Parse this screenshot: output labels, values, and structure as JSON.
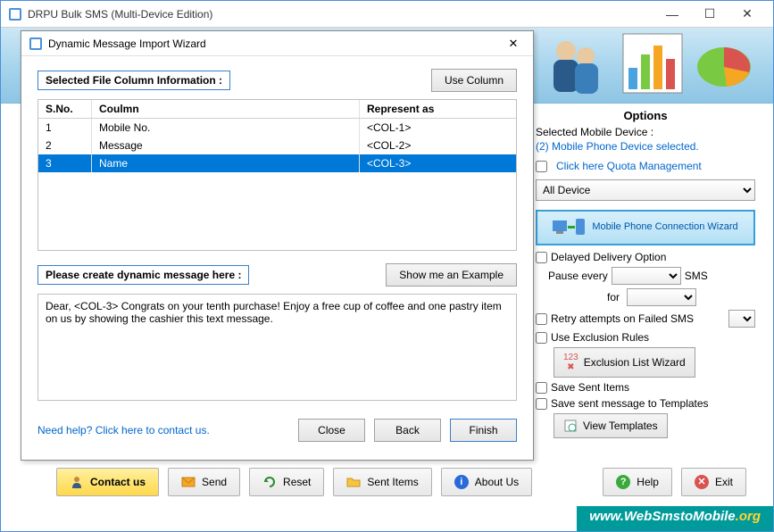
{
  "app": {
    "title": "DRPU Bulk SMS (Multi-Device Edition)"
  },
  "dialog": {
    "title": "Dynamic Message Import Wizard",
    "section1_label": "Selected File Column Information :",
    "use_column_btn": "Use Column",
    "table": {
      "headers": {
        "sno": "S.No.",
        "column": "Coulmn",
        "represent": "Represent as"
      },
      "rows": [
        {
          "sno": "1",
          "column": "Mobile No.",
          "represent": "<COL-1>",
          "selected": false
        },
        {
          "sno": "2",
          "column": "Message",
          "represent": "<COL-2>",
          "selected": false
        },
        {
          "sno": "3",
          "column": "Name",
          "represent": "<COL-3>",
          "selected": true
        }
      ]
    },
    "section2_label": "Please create dynamic message here :",
    "example_btn": "Show me an Example",
    "message_text": "Dear, <COL-3> Congrats on your tenth purchase! Enjoy a free cup of coffee and one pastry item on us by showing the cashier this text message.",
    "help_link": "Need help? Click here to contact us.",
    "close_btn": "Close",
    "back_btn": "Back",
    "finish_btn": "Finish"
  },
  "options": {
    "title": "Options",
    "selected_device_label": "Selected Mobile Device :",
    "selected_device_value": "(2) Mobile Phone Device selected.",
    "quota_link": "Click here Quota Management",
    "device_filter": "All Device",
    "wizard_btn": "Mobile Phone Connection  Wizard",
    "delayed_delivery": "Delayed Delivery Option",
    "pause_every": "Pause every",
    "sms_suffix": "SMS",
    "for_label": "for",
    "retry_label": "Retry attempts on Failed SMS",
    "exclusion_label": "Use Exclusion Rules",
    "exclusion_btn": "Exclusion List Wizard",
    "save_sent": "Save Sent Items",
    "save_templates": "Save sent message to Templates",
    "view_templates_btn": "View Templates"
  },
  "toolbar": {
    "contact": "Contact us",
    "send": "Send",
    "reset": "Reset",
    "sent_items": "Sent Items",
    "about": "About Us",
    "help": "Help",
    "exit": "Exit"
  },
  "watermark": {
    "prefix": "www.",
    "main": "WebSmstoMobile",
    "suffix": ".org"
  }
}
